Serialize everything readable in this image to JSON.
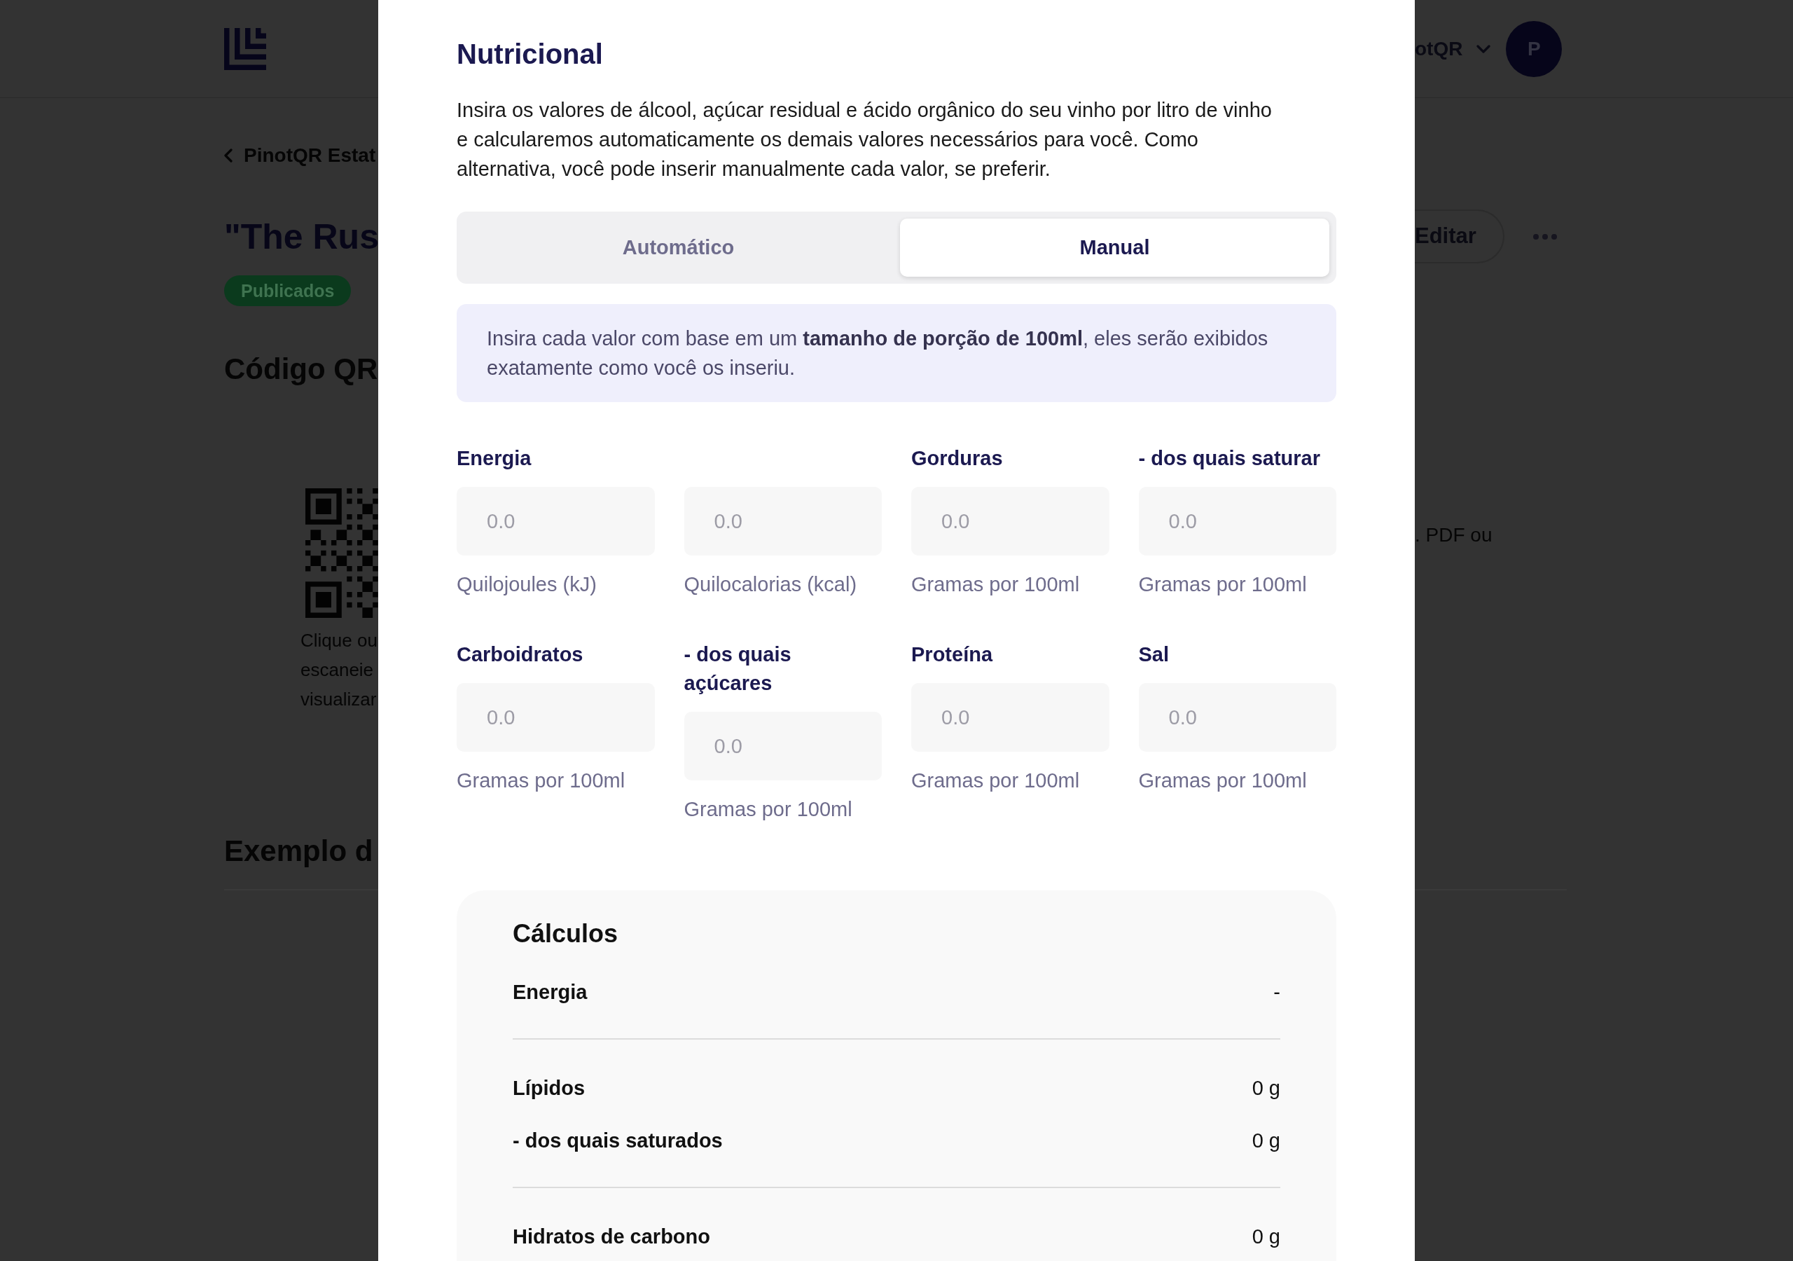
{
  "background_page": {
    "header": {
      "account_name": "otQR",
      "avatar_initial": "P"
    },
    "breadcrumb": "PinotQR Estat",
    "title": "\"The Rus",
    "status_badge": "Publicados",
    "edit_button": "Editar",
    "qr_section": {
      "heading": "Código QR",
      "caption_lines": [
        "Clique ou",
        "escaneie",
        "visualizar"
      ],
      "side_text": ". PDF ou"
    },
    "example_heading": "Exemplo d"
  },
  "modal": {
    "title": "Nutricional",
    "description": "Insira os valores de álcool, açúcar residual e ácido orgânico do seu vinho por litro de vinho e calcularemos automaticamente os demais valores necessários para você. Como alternativa, você pode inserir manualmente cada valor, se preferir.",
    "mode_tabs": [
      {
        "label": "Automático",
        "selected": false
      },
      {
        "label": "Manual",
        "selected": true
      }
    ],
    "info_note": "Insira cada valor com base em um **tamanho de porção de 100ml**, eles serão exibidos exatamente como você os inseriu.",
    "fields": [
      {
        "label": "Energia",
        "placeholder": "0.0",
        "hint": "Quilojoules (kJ)"
      },
      {
        "placeholder": "0.0",
        "hint": "Quilocalorias (kcal)"
      },
      {
        "label": "Gorduras",
        "placeholder": "0.0",
        "hint": "Gramas por 100ml"
      },
      {
        "label": "- dos quais saturar",
        "placeholder": "0.0",
        "hint": "Gramas por 100ml"
      },
      {
        "label": "Carboidratos",
        "placeholder": "0.0",
        "hint": "Gramas por 100ml"
      },
      {
        "label": "- dos quais açúcares",
        "placeholder": "0.0",
        "hint": "Gramas por 100ml"
      },
      {
        "label": "Proteína",
        "placeholder": "0.0",
        "hint": "Gramas por 100ml"
      },
      {
        "label": "Sal",
        "placeholder": "0.0",
        "hint": "Gramas por 100ml"
      }
    ],
    "calculations": {
      "title": "Cálculos",
      "groups": [
        {
          "rows": [
            {
              "label": "Energia",
              "value": "-"
            }
          ]
        },
        {
          "rows": [
            {
              "label": "Lípidos",
              "value": "0 g"
            },
            {
              "label": "- dos quais saturados",
              "value": "0 g"
            }
          ]
        },
        {
          "rows": [
            {
              "label": "Hidratos de carbono",
              "value": "0 g"
            }
          ]
        }
      ]
    }
  }
}
